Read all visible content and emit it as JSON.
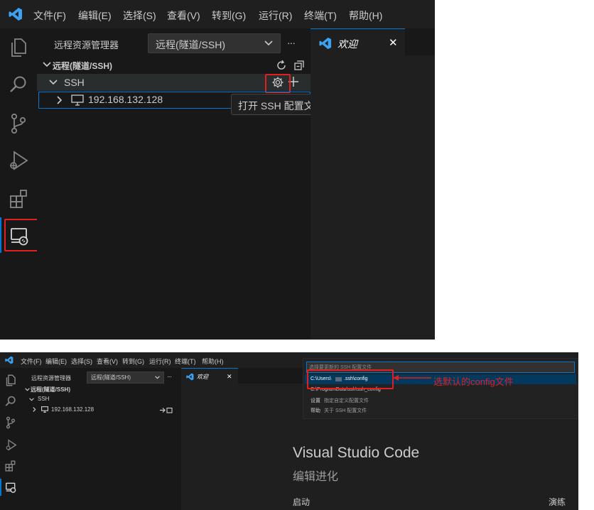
{
  "top": {
    "menu": [
      "文件(F)",
      "编辑(E)",
      "选择(S)",
      "查看(V)",
      "转到(G)",
      "运行(R)",
      "终端(T)",
      "帮助(H)"
    ],
    "explorer_title": "远程资源管理器",
    "remote_select": "远程(隧道/SSH)",
    "more": "···",
    "section": "远程(隧道/SSH)",
    "ssh_group": "SSH",
    "host": "192.168.132.128",
    "tab_label": "欢迎",
    "tab_close": "✕",
    "tooltip": "打开 SSH 配置文件"
  },
  "bottom": {
    "menu": [
      "文件(F)",
      "编辑(E)",
      "选择(S)",
      "查看(V)",
      "转到(G)",
      "运行(R)",
      "终端(T)",
      "帮助(H)"
    ],
    "explorer_title": "远程资源管理器",
    "remote_select": "远程(隧道/SSH)",
    "more": "···",
    "section": "远程(隧道/SSH)",
    "ssh_group": "SSH",
    "host": "192.168.132.128",
    "tab_label": "欢迎",
    "tab_close": "✕",
    "quickpick": {
      "placeholder": "选择要更新的 SSH 配置文件",
      "items": [
        {
          "path": "C:\\Users\\",
          "path_end": ".ssh\\config",
          "desc": ""
        },
        {
          "path": "C:\\ProgramData\\ssh\\ssh_config",
          "path_end": "",
          "desc": ""
        },
        {
          "path": "设置",
          "path_end": "",
          "desc": "指定自定义配置文件"
        },
        {
          "path": "帮助",
          "path_end": "",
          "desc": "关于 SSH 配置文件"
        }
      ]
    },
    "annotation": "选默认的config文件",
    "welcome_title": "Visual Studio Code",
    "welcome_subtitle": "编辑进化",
    "start_label": "启动",
    "walkthrough_label": "演练"
  },
  "colors": {
    "accent": "#0078d4",
    "highlight_red": "#e02020",
    "vscode_blue": "#3ba1f0"
  }
}
